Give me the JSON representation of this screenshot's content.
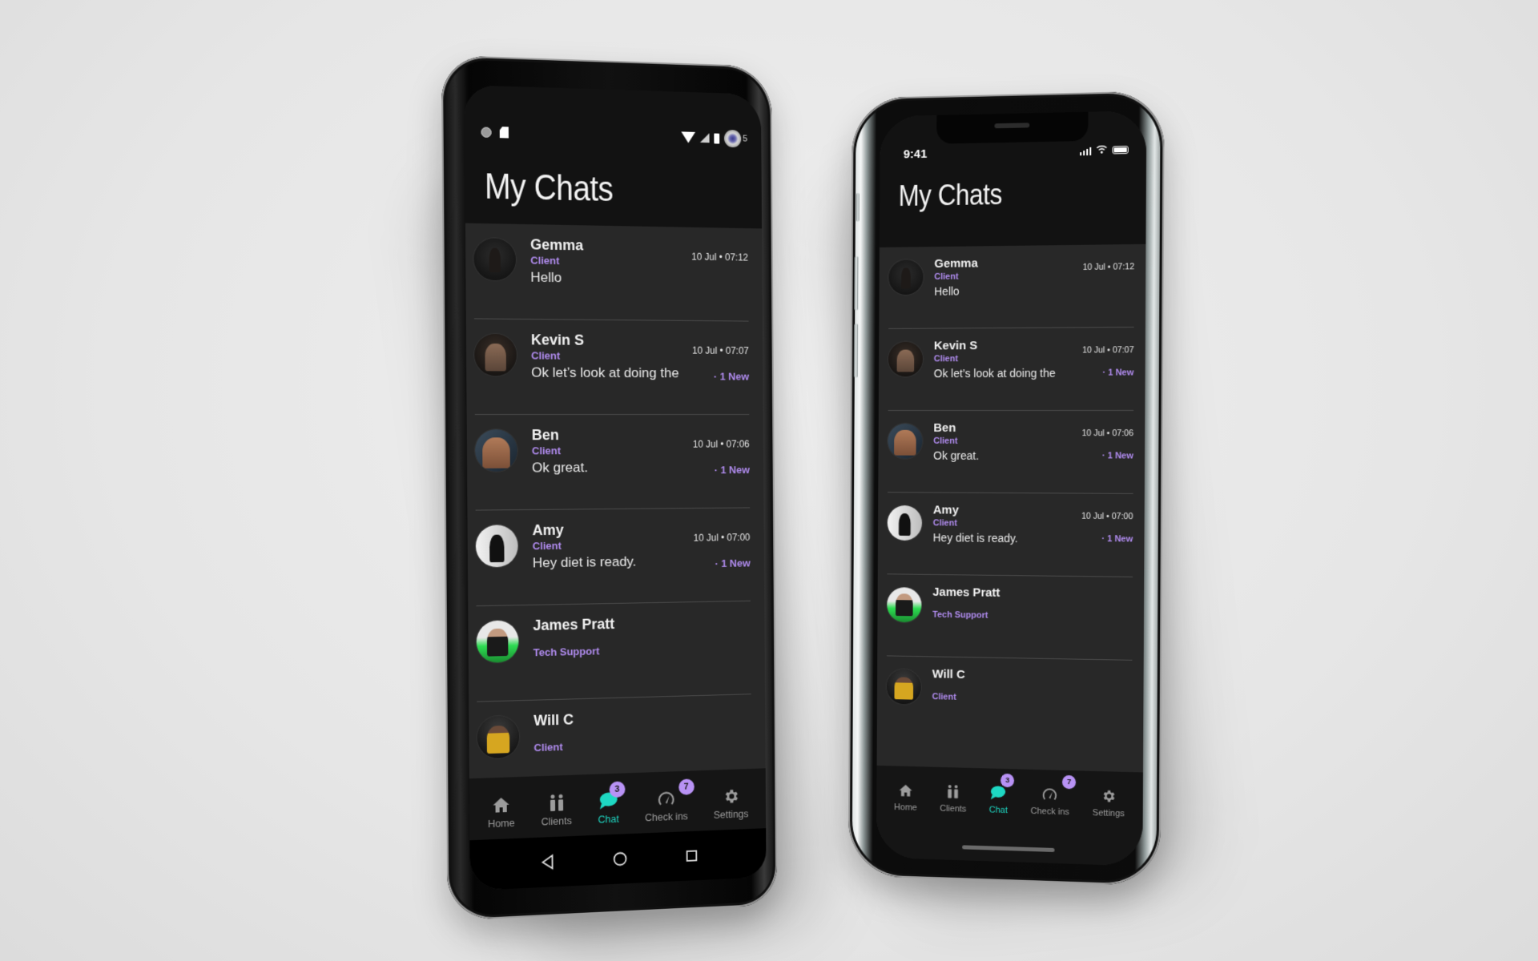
{
  "colors": {
    "accent_purple": "#b18cf0",
    "accent_teal": "#1ed8c3",
    "badge_purple": "#b892f5",
    "header_bg": "#121212",
    "list_bg": "#282828",
    "nav_bg": "#151515",
    "inactive_nav": "#9c9c9c"
  },
  "android_phone": {
    "status_bar": {
      "left_icons": [
        "record-icon",
        "sd-card-icon"
      ],
      "right_icons": [
        "wifi-icon",
        "signal-icon",
        "battery-icon"
      ],
      "trailing_text": "5"
    },
    "title": "My Chats"
  },
  "iphone": {
    "status_bar": {
      "time": "9:41",
      "right_icons": [
        "signal-bars-icon",
        "wifi-icon",
        "battery-icon"
      ]
    },
    "title": "My Chats"
  },
  "chats": [
    {
      "name": "Gemma",
      "role": "Client",
      "message": "Hello",
      "time": "10 Jul • 07:12",
      "new_label": ""
    },
    {
      "name": "Kevin S",
      "role": "Client",
      "message": "Ok let’s look at doing the",
      "time": "10 Jul • 07:07",
      "new_label": "· 1 New"
    },
    {
      "name": "Ben",
      "role": "Client",
      "message": "Ok great.",
      "time": "10 Jul • 07:06",
      "new_label": "· 1 New"
    },
    {
      "name": "Amy",
      "role": "Client",
      "message": "Hey diet is ready.",
      "time": "10 Jul • 07:00",
      "new_label": "· 1 New"
    },
    {
      "name": "James Pratt",
      "role": "Tech Support",
      "message": "",
      "time": "",
      "new_label": ""
    },
    {
      "name": "Will C",
      "role": "Client",
      "message": "",
      "time": "",
      "new_label": ""
    }
  ],
  "nav": [
    {
      "label": "Home",
      "icon": "home-icon",
      "badge": ""
    },
    {
      "label": "Clients",
      "icon": "clients-icon",
      "badge": ""
    },
    {
      "label": "Chat",
      "icon": "chat-bubble-icon",
      "badge": "3",
      "active": true
    },
    {
      "label": "Check ins",
      "icon": "gauge-icon",
      "badge": "7"
    },
    {
      "label": "Settings",
      "icon": "gear-icon",
      "badge": ""
    }
  ],
  "android_system_nav": [
    "back-icon",
    "home-circle-icon",
    "recents-icon"
  ]
}
